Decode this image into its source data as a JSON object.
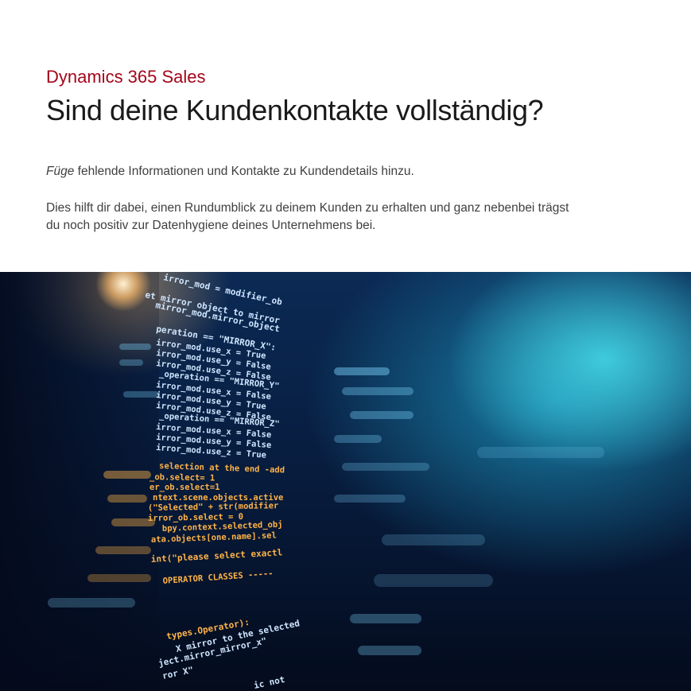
{
  "header": {
    "eyebrow": "Dynamics 365 Sales",
    "headline": "Sind deine Kundenkontakte vollständig?"
  },
  "body": {
    "p1_italic": "Füge",
    "p1_rest": " fehlende Informationen und Kontakte zu Kundendetails hinzu.",
    "p2_line1": "Dies hilft dir dabei, einen Rundumblick zu deinem Kunden zu erhalten und ganz nebenbei trägst",
    "p2_line2": "du noch positiv zur Datenhygiene deines Unternehmens bei."
  },
  "hero": {
    "code_lines": [
      "irror_mod = modifier_ob",
      "et mirror object to mirror",
      "mirror_mod.mirror_object",
      "peration == \"MIRROR_X\":",
      "irror_mod.use_x = True",
      "irror_mod.use_y = False",
      "irror_mod.use_z = False",
      "_operation == \"MIRROR_Y\"",
      "irror_mod.use_x = False",
      "irror_mod.use_y = True",
      "irror_mod.use_z = False",
      "_operation == \"MIRROR_Z\"",
      "irror_mod.use_x = False",
      "irror_mod.use_y = False",
      "irror_mod.use_z = True",
      "selection at the end -add",
      "_ob.select= 1",
      "er_ob.select=1",
      "ntext.scene.objects.active",
      "(\"Selected\" + str(modifier",
      "irror_ob.select = 0",
      "bpy.context.selected_obj",
      "ata.objects[one.name].sel",
      "int(\"please select exactl",
      "OPERATOR CLASSES -----",
      "types.Operator):",
      "X mirror to the selected",
      "ject.mirror_mirror_x\"",
      "ror X\"",
      "ic not"
    ],
    "colors": {
      "code_blue": "#cfe6ff",
      "code_orange": "#ffb347",
      "accent_red": "#a4061a"
    }
  }
}
